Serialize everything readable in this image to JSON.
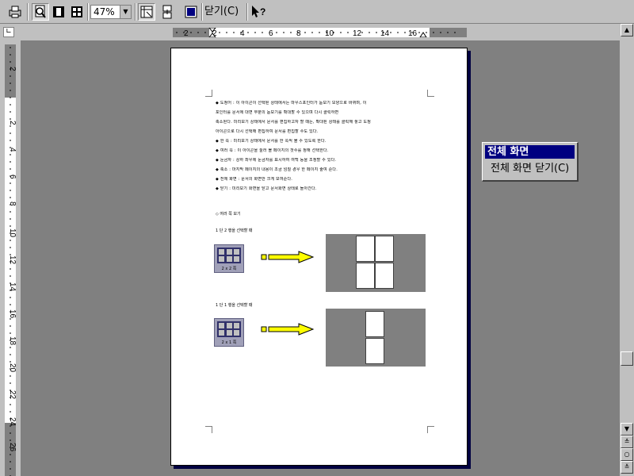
{
  "toolbar": {
    "zoom_value": "47%",
    "close_label": "닫기(C)",
    "buttons": [
      "printer-icon",
      "magnifier-icon",
      "one-page-icon",
      "multi-page-icon",
      "view-ruler-icon",
      "shrink-to-fit-icon",
      "full-screen-icon",
      "help-icon"
    ]
  },
  "ruler": {
    "h_labels": [
      "2",
      "2",
      "4",
      "6",
      "8",
      "10",
      "12",
      "14",
      "16"
    ],
    "v_labels": [
      "2",
      "2",
      "4",
      "6",
      "8",
      "10",
      "12",
      "14",
      "16",
      "18",
      "20",
      "22",
      "24",
      "26"
    ]
  },
  "document": {
    "lines": [
      "◆ 도청어 : 이 아이콘이 선택된 상태에서는 마우스포인터가 돋보기 모양으로 바뀌며, 이",
      "포인터를 문서에 대면 부분의 돋보기를 확대할 수 있으며 다시 클릭하면",
      "축소된다. 미리보기 상태에서 문서를 편집하고자 할 때는, 확대된 상태를 클릭해 놓고 도청",
      "아이콘으로 다시 선택해 편집하여 문서를 편집할 수도 있다.",
      "◆ 한 쪽 : 미리보기 상태에서 문서를 한 쪽씩 볼 수 있도록 한다.",
      "◆ 여러 쪽 : 이 아이콘을 눌러 볼 페이지의 갯수를 정해 선택한다.",
      "◆ 눈금자 : 상하 좌우에 눈금자를 표시하여 여백 등을 조정할 수 있다.",
      "◆ 축소 : 마지막 페이지의 내용이 조금 넘칠 경우 한 페이지 줄여 준다.",
      "◆ 전체 화면 : 문서의 화면만 크게 보여준다.",
      "◆ 닫기 : 미리보기 화면을 닫고 문서화면 상태로 돌아간다."
    ],
    "section": "◇ 여러 쪽 보기",
    "example1_label": "1 단 2 행을 선택할 때",
    "example2_label": "1 단 1 행을 선택할 때",
    "grid1_caption": "2 x 2 쪽",
    "grid2_caption": "2 x 1 쪽"
  },
  "full_screen_panel": {
    "title": "전체 화면",
    "close_label": "전체 화면 닫기(C)"
  }
}
